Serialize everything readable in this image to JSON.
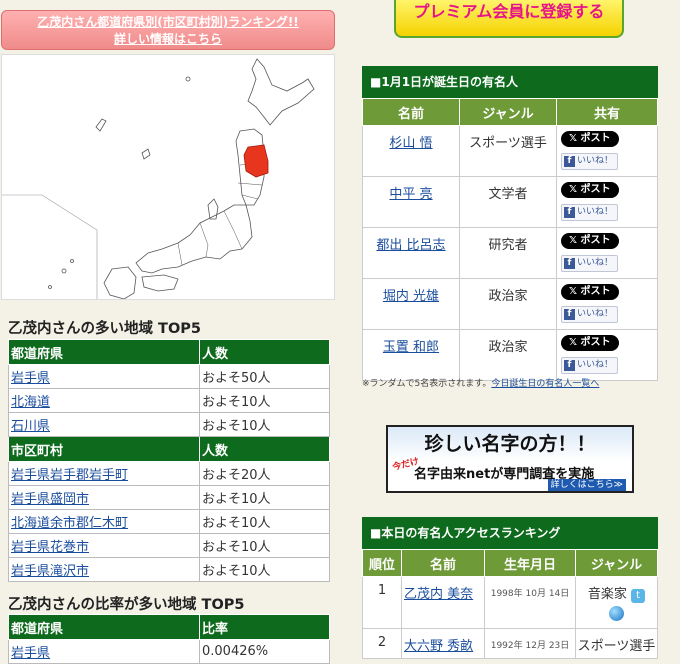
{
  "left": {
    "banner_line1": "乙茂内さん都道府県別(市区町村別)ランキング!!",
    "banner_line2": "詳しい情報はこちら",
    "top5_title": "乙茂内さんの多い地域 TOP5",
    "pref_header": "都道府県",
    "count_header": "人数",
    "prefectures": [
      {
        "name": "岩手県",
        "count": "およそ50人"
      },
      {
        "name": "北海道",
        "count": "およそ10人"
      },
      {
        "name": "石川県",
        "count": "およそ10人"
      }
    ],
    "city_header": "市区町村",
    "city_count_header": "人数",
    "cities": [
      {
        "name": "岩手県岩手郡岩手町",
        "count": "およそ20人"
      },
      {
        "name": "岩手県盛岡市",
        "count": "およそ10人"
      },
      {
        "name": "北海道余市郡仁木町",
        "count": "およそ10人"
      },
      {
        "name": "岩手県花巻市",
        "count": "およそ10人"
      },
      {
        "name": "岩手県滝沢市",
        "count": "およそ10人"
      }
    ],
    "ratio_title": "乙茂内さんの比率が多い地域 TOP5",
    "ratio_pref_header": "都道府県",
    "ratio_header": "比率",
    "ratios": [
      {
        "name": "岩手県",
        "ratio": "0.00426%"
      }
    ],
    "highlight_color": "#e8351e"
  },
  "right": {
    "premium_label": "プレミアム会員に登録する",
    "birthday_title": "■1月1日が誕生日の有名人",
    "col_name": "名前",
    "col_genre": "ジャンル",
    "col_share": "共有",
    "post_label": "ポスト",
    "like_label": "いいね！",
    "famous": [
      {
        "name": "杉山 悟",
        "genre": "スポーツ選手"
      },
      {
        "name": "中平 亮",
        "genre": "文学者"
      },
      {
        "name": "都出 比呂志",
        "genre": "研究者"
      },
      {
        "name": "堀内 光雄",
        "genre": "政治家"
      },
      {
        "name": "玉置 和郎",
        "genre": "政治家"
      }
    ],
    "random_note_prefix": "※ランダムで5名表示されます。",
    "random_note_link": "今日誕生日の有名人一覧へ",
    "ad": {
      "headline": "珍しい名字の方！！",
      "limited": "今だけ",
      "body": "名字由来netが専門調査を実施",
      "more": "詳しくはこちら≫"
    },
    "access_title": "■本日の有名人アクセスランキング",
    "acc_col_rank": "順位",
    "acc_col_name": "名前",
    "acc_col_birth": "生年月日",
    "acc_col_genre": "ジャンル",
    "access": [
      {
        "rank": "1",
        "name": "乙茂内 美奈",
        "birth": "1998年 10月 14日",
        "genre": "音楽家"
      },
      {
        "rank": "2",
        "name": "大六野 秀畝",
        "birth": "1992年 12月 23日",
        "genre": "スポーツ選手"
      }
    ]
  }
}
